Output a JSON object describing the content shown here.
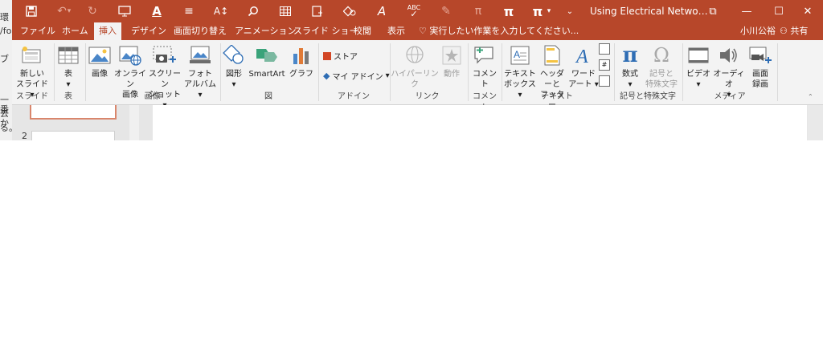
{
  "window": {
    "title": "Using Electrical Netwo…",
    "controls": [
      "⧉",
      "—",
      "☐",
      "✕"
    ]
  },
  "tabs": [
    "ファイル",
    "ホーム",
    "挿入",
    "デザイン",
    "画面切り替え",
    "アニメーション",
    "スライド ショー",
    "校閲",
    "表示"
  ],
  "active_tab": "挿入",
  "tell_me": "実行したい作業を入力してください...",
  "user_name": "小川公裕",
  "share_label": "共有",
  "ribbon": {
    "slides": {
      "new_slide": [
        "新しい",
        "スライド"
      ],
      "group": "スライド"
    },
    "tables": {
      "table": "表",
      "group": "表"
    },
    "images": {
      "picture": "画像",
      "online_pictures": [
        "オンライン",
        "画像"
      ],
      "screenshot": [
        "スクリーン",
        "ショット"
      ],
      "photo_album": [
        "フォト",
        "アルバム"
      ],
      "group": "画像"
    },
    "illustrations": {
      "shapes": "図形",
      "smartart": "SmartArt",
      "chart": "グラフ",
      "group": "図"
    },
    "addins": {
      "store": "ストア",
      "my_addins": "マイ アドイン",
      "group": "アドイン"
    },
    "links": {
      "hyperlink": "ハイパーリンク",
      "action": "動作",
      "group": "リンク"
    },
    "comments": {
      "comment": "コメント",
      "group": "コメント"
    },
    "text": {
      "textbox": [
        "テキスト",
        "ボックス"
      ],
      "header_footer": [
        "ヘッダーと",
        "フッター"
      ],
      "wordart": [
        "ワード",
        "アート"
      ],
      "group": "テキスト"
    },
    "symbols": {
      "equation": "数式",
      "symbol": [
        "記号と",
        "特殊文字"
      ],
      "group": "記号と特殊文字"
    },
    "media": {
      "video": "ビデオ",
      "audio": "オーディオ",
      "screen_recording": [
        "画面",
        "録画"
      ],
      "group": "メディア"
    }
  },
  "thumbnail_pane": {
    "second_slide_number": "2"
  },
  "backdrop_chars": [
    "環",
    "ブ",
    "/fo",
    "一番",
    "去か",
    "る。"
  ],
  "colors": {
    "accent": "#b7472a",
    "ribbon_bg": "#f3f3f3"
  }
}
